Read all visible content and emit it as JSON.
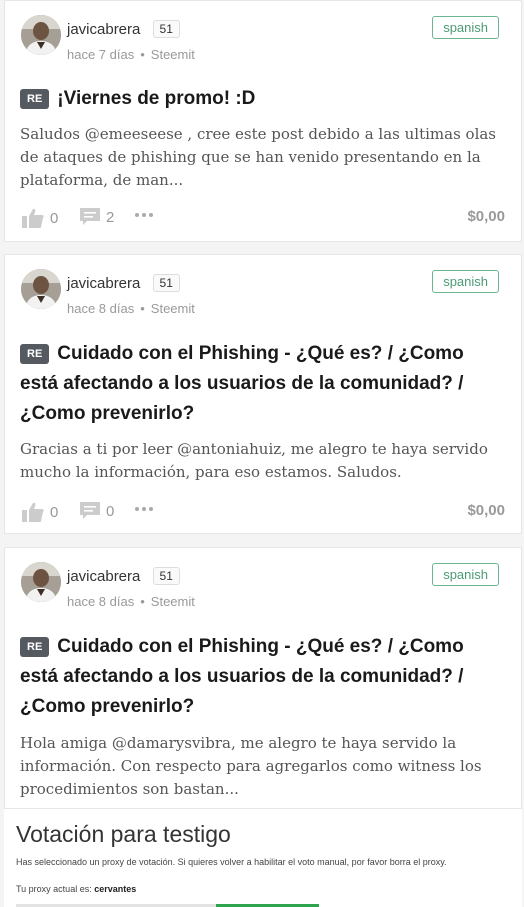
{
  "posts": [
    {
      "author": "javicabrera",
      "reputation": "51",
      "time": "hace 7 días",
      "source": "Steemit",
      "tag": "spanish",
      "badge": "RE",
      "title": "¡Viernes de promo! :D",
      "body": "Saludos @emeeseese , cree este post debido a las ultimas olas de ataques de phishing que se han venido presentando en la plataforma, de man...",
      "votes": "0",
      "comments": "2",
      "payout": "$0,00"
    },
    {
      "author": "javicabrera",
      "reputation": "51",
      "time": "hace 8 días",
      "source": "Steemit",
      "tag": "spanish",
      "badge": "RE",
      "title": "Cuidado con el Phishing - ¿Qué es? / ¿Como está afectando a los usuarios de la comunidad? / ¿Como prevenirlo?",
      "body": "Gracias a ti por leer @antoniahuiz, me alegro te haya servido mucho la información, para eso estamos. Saludos.",
      "votes": "0",
      "comments": "0",
      "payout": "$0,00"
    },
    {
      "author": "javicabrera",
      "reputation": "51",
      "time": "hace 8 días",
      "source": "Steemit",
      "tag": "spanish",
      "badge": "RE",
      "title": "Cuidado con el Phishing - ¿Qué es? / ¿Como está afectando a los usuarios de la comunidad? / ¿Como prevenirlo?",
      "body": "Hola amiga @damarysvibra, me alegro te haya servido la información. Con respecto para agregarlos como witness los procedimientos son bastan..."
    }
  ],
  "witness": {
    "title": "Votación para testigo",
    "description": "Has seleccionado un proxy de votación. Si quieres volver a habilitar el voto manual, por favor borra el proxy.",
    "proxy_label": "Tu proxy actual es:",
    "proxy_value": "cervantes"
  },
  "icons": [
    "avatar",
    "thumbs-up-icon",
    "comment-icon",
    "more-icon"
  ]
}
